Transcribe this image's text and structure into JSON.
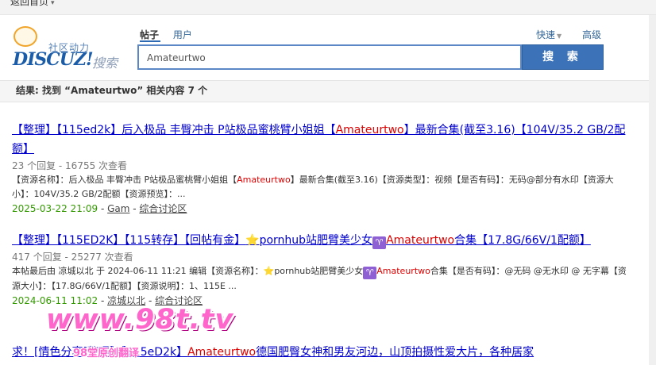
{
  "topbar": {
    "back_label": "返回首页",
    "caret": "▾"
  },
  "logo": {
    "tagline": "社区动力",
    "wordmark": "DISCUZ!",
    "search_word": "搜索"
  },
  "search": {
    "tab_posts": "帖子",
    "tab_users": "用户",
    "quick_label": "快速",
    "advanced_label": "高级",
    "query_value": "Amateurtwo",
    "button_label": "搜 索"
  },
  "result_summary": "结果: 找到 “Amateurtwo” 相关内容 7 个",
  "results": [
    {
      "title_pre": "【整理】【115ed2k】后入极品 丰臀冲击 P站极品蜜桃臂小姐姐【",
      "title_hl": "Amateurtwo",
      "title_post": "】最新合集(截至3.16)【104V/35.2 GB/2配额】",
      "stats": "23 个回复 - 16755 次查看",
      "excerpt_pre": "【资源名称】：后入极品 丰臀冲击 P站极品蜜桃臂小姐姐【",
      "excerpt_hl": "Amateurtwo",
      "excerpt_post": "】最新合集(截至3.16)【资源类型】：视频【是否有码】：无码@部分有水印【资源大小】：104V/35.2 GB/2配额【资源预览】：...",
      "date": "2025-03-22 21:09",
      "sep1": " - ",
      "author": "Gam",
      "sep2": " - ",
      "forum": "综合讨论区"
    },
    {
      "title_pre": "【整理】【115ED2K】【115转存】【回帖有金】",
      "title_mid": "pornhub站肥臂美少女",
      "title_hl": "Amateurtwo",
      "title_post": "合集【17.8G/66V/1配额】",
      "stats": "417 个回复 - 25277 次查看",
      "excerpt_pre": "本帖最后由 凉城以北 于 2024-06-11 11:21 编辑【资源名称】：",
      "excerpt_mid": "pornhub站肥臂美少女",
      "excerpt_hl": "Amateurtwo",
      "excerpt_post": "合集【是否有码】：@无码 @无水印 @ 无字幕【资源大小】：【17.8G/66V/1配额】【资源说明】：1、115E ...",
      "date": "2024-06-11 11:02",
      "sep1": " - ",
      "author": "凉城以北",
      "sep2": " - ",
      "forum": "综合讨论区"
    },
    {
      "title_pre": "求！[情色分享]整理】【115eD2k】",
      "title_hl": "Amateurtwo",
      "title_post": "德国肥臀女神和男友河边，山顶拍摄性爱大片，各种居家"
    }
  ],
  "icons": {
    "star": "⭐",
    "aries": "♈"
  },
  "watermark": {
    "big": "www.98t.tv",
    "small": "98堂原创翻译"
  },
  "colors": {
    "link": "#0000cc",
    "highlight": "#dd0000",
    "date": "#339900",
    "button": "#3b72b8"
  }
}
